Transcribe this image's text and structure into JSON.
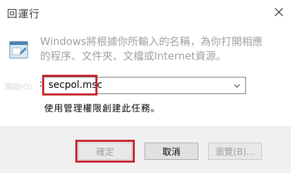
{
  "window": {
    "title": "回運行",
    "close_icon": "close-icon"
  },
  "body": {
    "icon": "run-icon",
    "description": "Windows將根據你所輸入的名稱，為你打開相應的程序、文件夾、文檔或Internet資源。",
    "open_label": ":",
    "ghost_label": "開啟(O):",
    "command_value": "secpol.msc",
    "admin_note": "使用管理權限創建此任務。"
  },
  "buttons": {
    "ok_label": "確定",
    "cancel_label": "取消",
    "browse_label": "瀏覽(B)..."
  },
  "colors": {
    "highlight": "#c4262e",
    "button_bar": "#f0f0f0",
    "disabled_text": "#a0a0a0"
  }
}
